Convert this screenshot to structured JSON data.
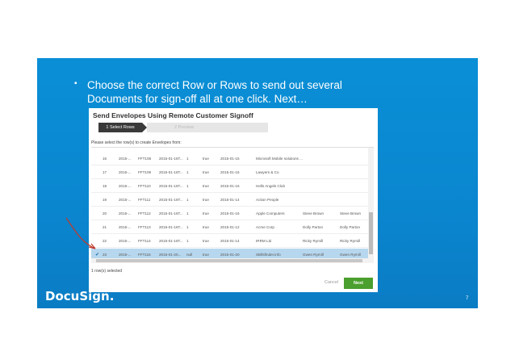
{
  "slide": {
    "bullet": "▪",
    "text_line1": "Choose the correct Row or Rows to send out several",
    "text_line2": "Documents for sign-off all at one click. Next…",
    "page_number": "7",
    "logo": "DocuSign."
  },
  "dialog": {
    "title": "Send Envelopes Using Remote Customer Signoff",
    "step1": "1 Select Rows",
    "step2": "2 Preview",
    "instruction": "Please select the row(s) to create Envelopes from:",
    "selection_count": "1 row(s) selected",
    "cancel_label": "Cancel",
    "next_label": "Next",
    "rows": [
      {
        "id": "16",
        "c1": "2015-...",
        "c2": "FFT108",
        "c3": "2015-01-16T...",
        "c4": "1",
        "c5": "true",
        "c6": "2015-01-15",
        "c7": "Microsoft Mobile solutions ...",
        "c8": "",
        "c9": "",
        "selected": false
      },
      {
        "id": "17",
        "c1": "2015-...",
        "c2": "FFT109",
        "c3": "2015-01-16T...",
        "c4": "1",
        "c5": "true",
        "c6": "2015-01-16",
        "c7": "Lawyers & Co",
        "c8": "",
        "c9": "",
        "selected": false
      },
      {
        "id": "18",
        "c1": "2015-...",
        "c2": "FFT110",
        "c3": "2015-01-16T...",
        "c4": "1",
        "c5": "true",
        "c6": "2015-01-16",
        "c7": "Hells Angels Club",
        "c8": "",
        "c9": "",
        "selected": false
      },
      {
        "id": "19",
        "c1": "2015-...",
        "c2": "FFT111",
        "c3": "2015-01-16T...",
        "c4": "1",
        "c5": "true",
        "c6": "2015-01-14",
        "c7": "Action People",
        "c8": "",
        "c9": "",
        "selected": false
      },
      {
        "id": "20",
        "c1": "2015-...",
        "c2": "FFT112",
        "c3": "2015-01-16T...",
        "c4": "1",
        "c5": "true",
        "c6": "2015-01-16",
        "c7": "Apple Computers",
        "c8": "Steve Brown",
        "c9": "Steve Brown",
        "selected": false
      },
      {
        "id": "21",
        "c1": "2015-...",
        "c2": "FFT113",
        "c3": "2015-01-16T...",
        "c4": "1",
        "c5": "true",
        "c6": "2015-01-12",
        "c7": "Acme Corp",
        "c8": "Dolly Parton",
        "c9": "Dolly Parton",
        "selected": false
      },
      {
        "id": "22",
        "c1": "2015-...",
        "c2": "FFT114",
        "c3": "2015-01-16T...",
        "c4": "1",
        "c5": "true",
        "c6": "2015-01-14",
        "c7": "IRRM Ltd",
        "c8": "Ricky Rymill",
        "c9": "Ricky Rymill",
        "selected": false
      },
      {
        "id": "23",
        "c1": "2015-...",
        "c2": "FFT115",
        "c3": "2015-01-20...",
        "c4": "null",
        "c5": "true",
        "c6": "2015-01-20",
        "c7": "Skillsfinder.info",
        "c8": "Gwen Rymill",
        "c9": "Gwen Rymill",
        "selected": true
      }
    ]
  },
  "colors": {
    "slide_bg": "#0a8fd6",
    "next_button": "#4a9f2e",
    "selected_row": "#b7d7ee",
    "arrow": "#c0392b"
  }
}
